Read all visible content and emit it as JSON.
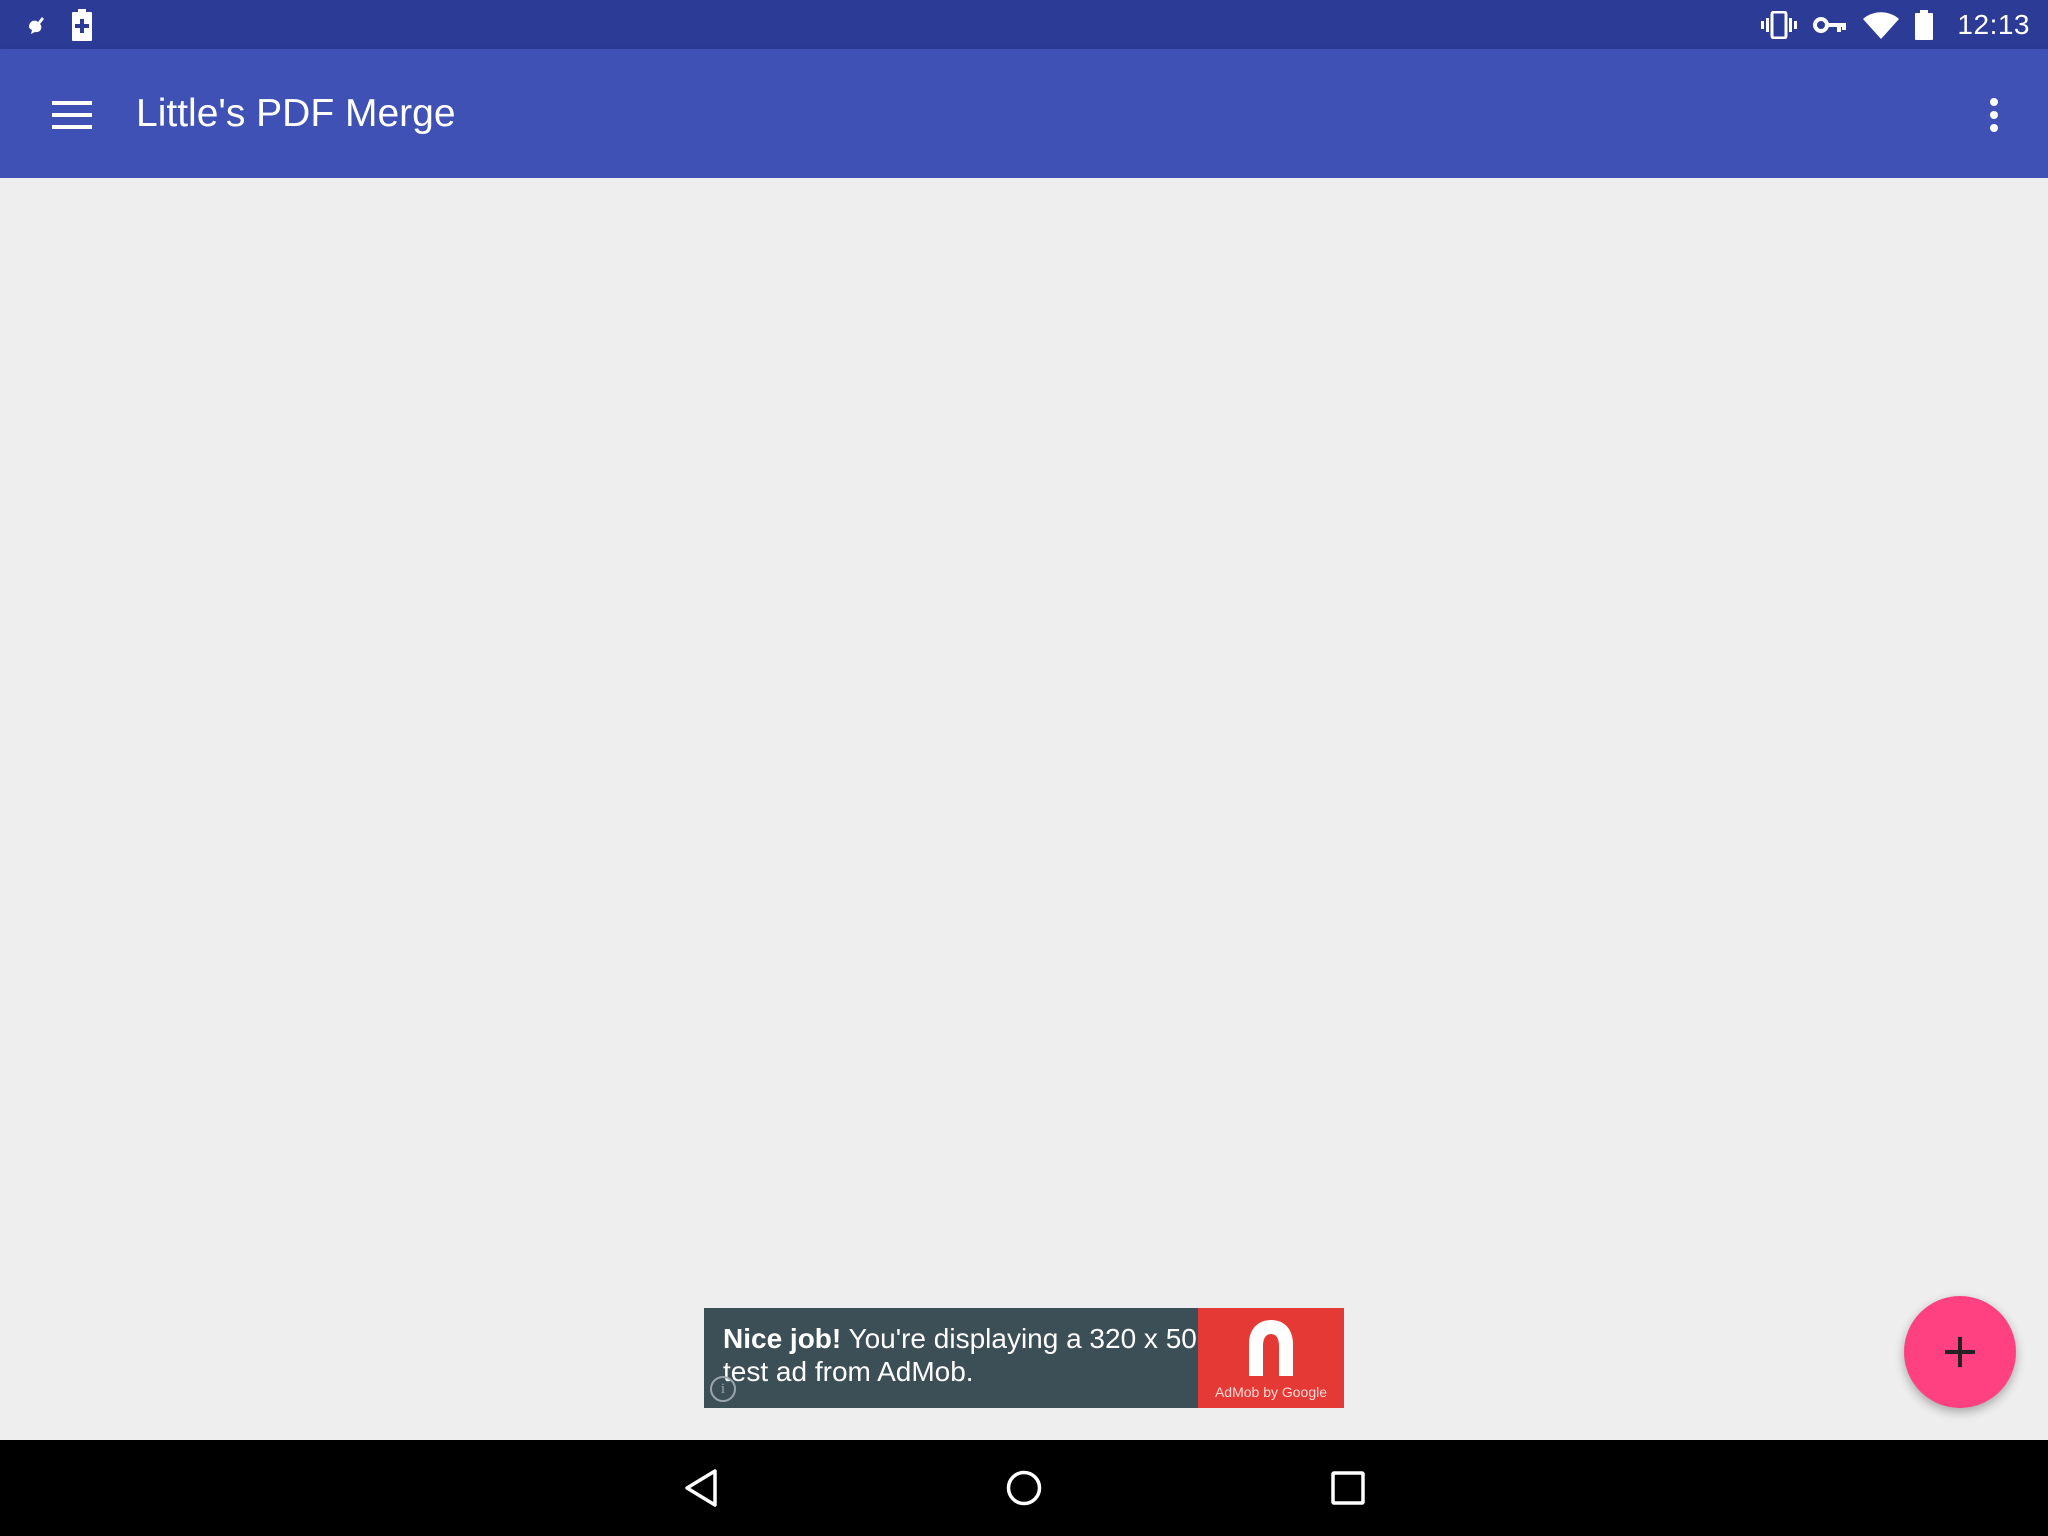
{
  "status_bar": {
    "time": "12:13",
    "background": "#2c3b95",
    "left_icons": [
      "notification-app-icon",
      "battery-charging-icon"
    ],
    "right_icons": [
      "vibrate-icon",
      "vpn-key-icon",
      "wifi-icon",
      "battery-icon"
    ]
  },
  "app_bar": {
    "title": "Little's PDF Merge",
    "background": "#3f51b5",
    "nav_icon": "menu-icon",
    "overflow_icon": "more-vert-icon"
  },
  "ad": {
    "headline_bold": "Nice job!",
    "headline_rest": " You're displaying a 320 x 50 test ad from AdMob.",
    "brand_caption": "AdMob by Google",
    "info_glyph": "i",
    "background": "#3d4f56",
    "brand_color": "#e53935"
  },
  "fab": {
    "icon": "add-icon",
    "color": "#ff4081"
  },
  "nav_bar": {
    "buttons": [
      "back-icon",
      "home-icon",
      "recents-icon"
    ]
  }
}
